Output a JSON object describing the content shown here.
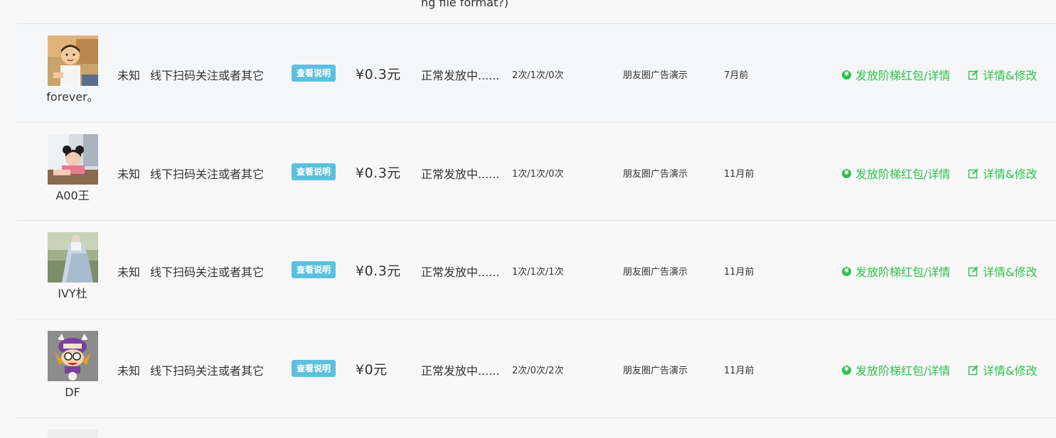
{
  "top_fragment": "ng file format?)",
  "rows": [
    {
      "nickname": "forever。",
      "gender": "未知",
      "source": "线下扫码关注或者其它",
      "badge": "查看说明",
      "price": "¥0.3元",
      "status": "正常发放中......",
      "counts": "2次/1次/0次",
      "campaign": "朋友圈广告演示",
      "time": "7月前",
      "action_ladder": "发放阶梯红包/详情",
      "action_edit": "详情&修改",
      "avatar_icon": "child-photo-avatar"
    },
    {
      "nickname": "A00王",
      "gender": "未知",
      "source": "线下扫码关注或者其它",
      "badge": "查看说明",
      "price": "¥0.3元",
      "status": "正常发放中......",
      "counts": "1次/1次/0次",
      "campaign": "朋友圈广告演示",
      "time": "11月前",
      "action_ladder": "发放阶梯红包/详情",
      "action_edit": "详情&修改",
      "avatar_icon": "girl-photo-avatar"
    },
    {
      "nickname": "IVY杜",
      "gender": "未知",
      "source": "线下扫码关注或者其它",
      "badge": "查看说明",
      "price": "¥0.3元",
      "status": "正常发放中......",
      "counts": "1次/1次/1次",
      "campaign": "朋友圈广告演示",
      "time": "11月前",
      "action_ladder": "发放阶梯红包/详情",
      "action_edit": "详情&修改",
      "avatar_icon": "dress-photo-avatar"
    },
    {
      "nickname": "DF",
      "gender": "未知",
      "source": "线下扫码关注或者其它",
      "badge": "查看说明",
      "price": "¥0元",
      "status": "正常发放中......",
      "counts": "2次/0次/2次",
      "campaign": "朋友圈广告演示",
      "time": "11月前",
      "action_ladder": "发放阶梯红包/详情",
      "action_edit": "详情&修改",
      "avatar_icon": "cartoon-avatar"
    }
  ],
  "colors": {
    "accent_green": "#2ec24c",
    "badge_blue": "#5bc0de",
    "row_bg": "#f8f8f9",
    "divider": "#e6e6e6"
  }
}
